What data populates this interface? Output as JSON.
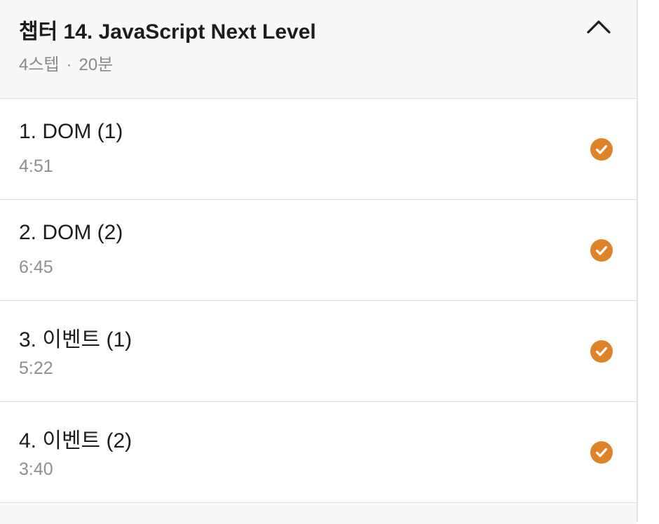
{
  "chapter": {
    "title": "챕터 14. JavaScript Next Level",
    "steps_count": "4스텝",
    "separator": "·",
    "total_time": "20분",
    "expanded": true
  },
  "steps": [
    {
      "title": "1. DOM (1)",
      "duration": "4:51",
      "completed": true
    },
    {
      "title": "2. DOM (2)",
      "duration": "6:45",
      "completed": true
    },
    {
      "title": "3. 이벤트 (1)",
      "duration": "5:22",
      "completed": true
    },
    {
      "title": "4. 이벤트 (2)",
      "duration": "3:40",
      "completed": true
    }
  ],
  "colors": {
    "check": "#e08228",
    "header_bg": "#f8f8f8",
    "title_text": "#1d1d1d",
    "meta_text": "#8a8a8a"
  },
  "icons": {
    "collapse": "chevron-up-icon",
    "completed": "check-circle-icon"
  }
}
